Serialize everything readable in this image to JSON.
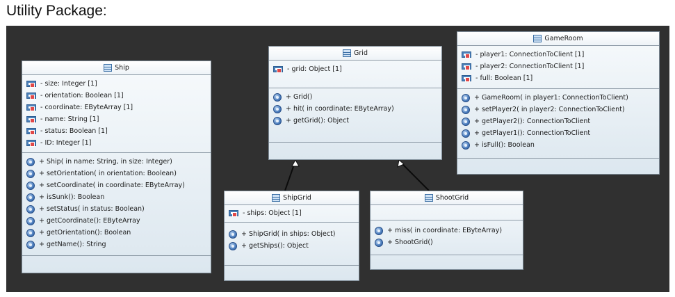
{
  "page": {
    "title": "Utility Package:"
  },
  "classes": {
    "ship": {
      "name": "Ship",
      "attributes": [
        "- size: Integer [1]",
        "- orientation: Boolean [1]",
        "- coordinate: EByteArray [1]",
        "- name: String [1]",
        "- status: Boolean [1]",
        "- ID: Integer [1]"
      ],
      "operations": [
        "+ Ship( in name: String,   in size: Integer)",
        "+ setOrientation( in orientation: Boolean)",
        "+ setCoordinate( in coordinate: EByteArray)",
        "+ isSunk(): Boolean",
        "+ setStatus( in status: Boolean)",
        "+ getCoordinate(): EByteArray",
        "+ getOrientation(): Boolean",
        "+ getName(): String"
      ]
    },
    "grid": {
      "name": "Grid",
      "attributes": [
        "- grid: Object [1]"
      ],
      "operations": [
        "+ Grid()",
        "+ hit( in coordinate: EByteArray)",
        "+ getGrid(): Object"
      ]
    },
    "gameroom": {
      "name": "GameRoom",
      "attributes": [
        "- player1: ConnectionToClient [1]",
        "- player2: ConnectionToClient [1]",
        "- full: Boolean [1]"
      ],
      "operations": [
        "+ GameRoom( in player1: ConnectionToClient)",
        "+ setPlayer2( in player2: ConnectionToClient)",
        "+ getPlayer2(): ConnectionToClient",
        "+ getPlayer1(): ConnectionToClient",
        "+ isFull(): Boolean"
      ]
    },
    "shipgrid": {
      "name": "ShipGrid",
      "attributes": [
        "- ships: Object [1]"
      ],
      "operations": [
        "+ ShipGrid( in ships: Object)",
        "+ getShips(): Object"
      ]
    },
    "shootgrid": {
      "name": "ShootGrid",
      "attributes": [],
      "operations": [
        "+ miss( in coordinate: EByteArray)",
        "+ ShootGrid()"
      ]
    }
  },
  "colors": {
    "canvas": "#303030",
    "class_fill": "#dce7ef",
    "border": "#7f8d99",
    "icon_blue": "#4a7fb8"
  }
}
